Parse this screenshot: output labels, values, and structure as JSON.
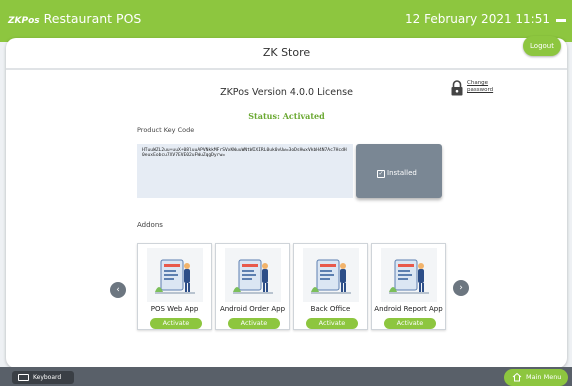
{
  "topbar": {
    "logo_text": "ZKPos",
    "app_title": "Restaurant POS",
    "datetime": "12 February 2021 11:51"
  },
  "store": {
    "title": "ZK Store",
    "logout_label": "Logout"
  },
  "license": {
    "title": "ZKPos Version 4.0.0 License",
    "status": "Status: Activated",
    "change_password_label": "Change password",
    "product_key_label": "Product Key Code",
    "product_key_value": "HTuuWZL2uu+uuX+08luuAPVNkkMFrSVxKWuuWNtWIXIRL0uk0vUw=3oDsHwxVkbH4N7Ac7HcdH0euxEobcu7XV7EVE02uFWuZqgDyrw=",
    "installed_label": "Installed"
  },
  "addons": {
    "label": "Addons",
    "items": [
      {
        "name": "POS Web App",
        "action": "Activate"
      },
      {
        "name": "Android Order App",
        "action": "Activate"
      },
      {
        "name": "Back Office",
        "action": "Activate"
      },
      {
        "name": "Android Report App",
        "action": "Activate"
      }
    ]
  },
  "bottombar": {
    "keyboard_label": "Keyboard",
    "main_menu_label": "Main Menu"
  },
  "colors": {
    "accent": "#8dc63f",
    "installed_bg": "#7a8794",
    "bottombar_bg": "#596069"
  },
  "icons": [
    "lock-icon",
    "checkbox-icon",
    "chevron-left-icon",
    "chevron-right-icon",
    "keyboard-icon",
    "home-icon",
    "minimize-icon"
  ]
}
